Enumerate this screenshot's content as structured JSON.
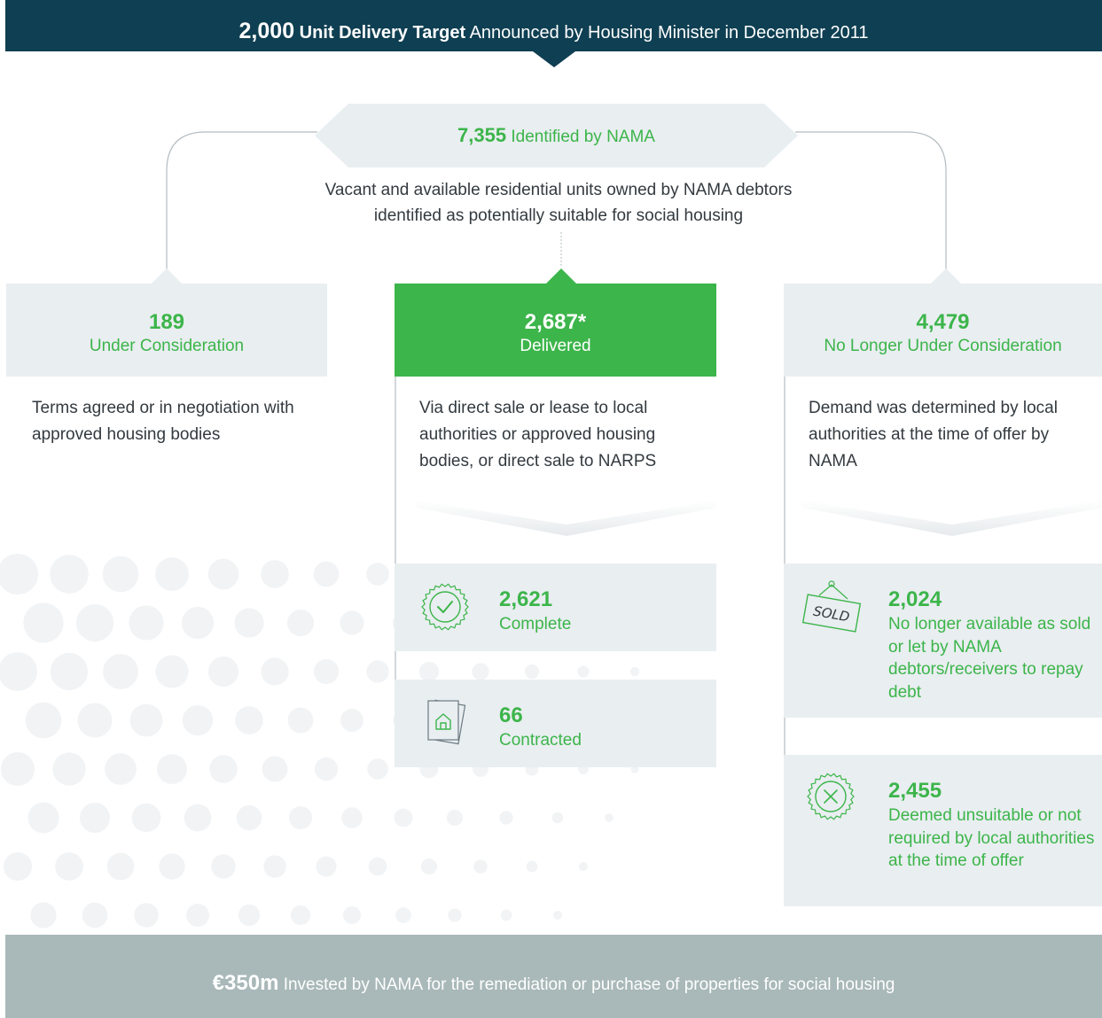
{
  "banner": {
    "number": "2,000",
    "bold_text": "Unit Delivery Target",
    "text": "Announced by Housing Minister in December 2011"
  },
  "identified": {
    "number": "7,355",
    "label": "Identified by NAMA",
    "description_line1": "Vacant and available residential units owned by NAMA debtors",
    "description_line2": "identified as potentially suitable for social housing"
  },
  "columns": {
    "left": {
      "number": "189",
      "label": "Under Consideration",
      "description": "Terms agreed or in negotiation with approved housing bodies"
    },
    "center": {
      "number": "2,687*",
      "label": "Delivered",
      "description": "Via direct sale or lease to local authorities or approved housing bodies, or direct sale to NARPS",
      "cards": [
        {
          "number": "2,621",
          "label": "Complete",
          "icon": "checkmark-seal-icon"
        },
        {
          "number": "66",
          "label": "Contracted",
          "icon": "house-document-icon"
        }
      ]
    },
    "right": {
      "number": "4,479",
      "label": "No Longer Under Consideration",
      "description": "Demand was determined by local authorities at the time of offer by NAMA",
      "cards": [
        {
          "number": "2,024",
          "label": "No longer available as sold or let by NAMA debtors/receivers to repay debt",
          "icon": "sold-sign-icon",
          "icon_text": "SOLD"
        },
        {
          "number": "2,455",
          "label": "Deemed unsuitable or not required by local authorities at the time of offer",
          "icon": "cross-seal-icon"
        }
      ]
    }
  },
  "footer": {
    "amount": "€350m",
    "text": "Invested by NAMA for the remediation or purchase of properties for social housing"
  },
  "colors": {
    "navy": "#0f3f52",
    "green": "#3cb54a",
    "light_panel": "#e9eef1",
    "footer_grey": "#a9b8b9",
    "text": "#333a3f"
  }
}
